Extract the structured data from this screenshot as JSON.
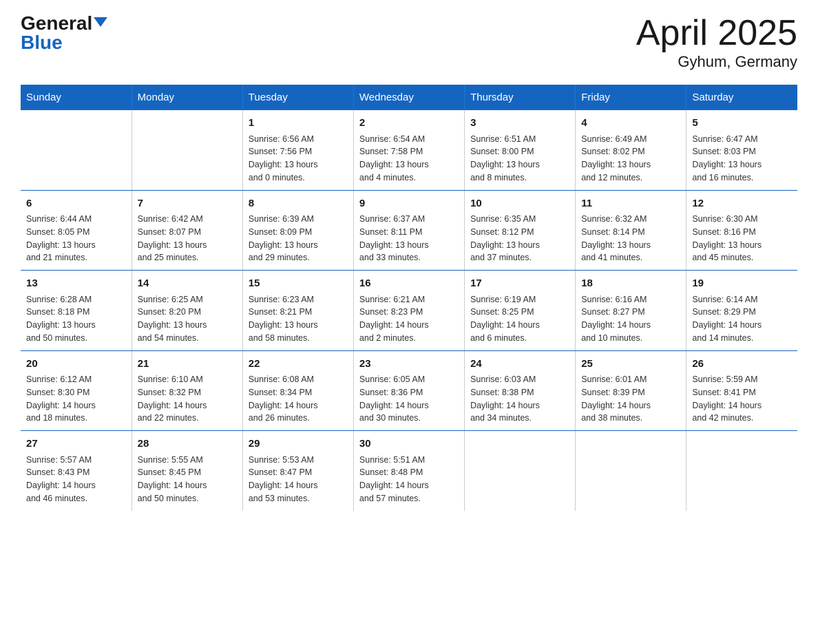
{
  "header": {
    "logo_general": "General",
    "logo_blue": "Blue",
    "month_title": "April 2025",
    "location": "Gyhum, Germany"
  },
  "days_of_week": [
    "Sunday",
    "Monday",
    "Tuesday",
    "Wednesday",
    "Thursday",
    "Friday",
    "Saturday"
  ],
  "weeks": [
    {
      "days": [
        {
          "number": "",
          "info": ""
        },
        {
          "number": "",
          "info": ""
        },
        {
          "number": "1",
          "info": "Sunrise: 6:56 AM\nSunset: 7:56 PM\nDaylight: 13 hours\nand 0 minutes."
        },
        {
          "number": "2",
          "info": "Sunrise: 6:54 AM\nSunset: 7:58 PM\nDaylight: 13 hours\nand 4 minutes."
        },
        {
          "number": "3",
          "info": "Sunrise: 6:51 AM\nSunset: 8:00 PM\nDaylight: 13 hours\nand 8 minutes."
        },
        {
          "number": "4",
          "info": "Sunrise: 6:49 AM\nSunset: 8:02 PM\nDaylight: 13 hours\nand 12 minutes."
        },
        {
          "number": "5",
          "info": "Sunrise: 6:47 AM\nSunset: 8:03 PM\nDaylight: 13 hours\nand 16 minutes."
        }
      ]
    },
    {
      "days": [
        {
          "number": "6",
          "info": "Sunrise: 6:44 AM\nSunset: 8:05 PM\nDaylight: 13 hours\nand 21 minutes."
        },
        {
          "number": "7",
          "info": "Sunrise: 6:42 AM\nSunset: 8:07 PM\nDaylight: 13 hours\nand 25 minutes."
        },
        {
          "number": "8",
          "info": "Sunrise: 6:39 AM\nSunset: 8:09 PM\nDaylight: 13 hours\nand 29 minutes."
        },
        {
          "number": "9",
          "info": "Sunrise: 6:37 AM\nSunset: 8:11 PM\nDaylight: 13 hours\nand 33 minutes."
        },
        {
          "number": "10",
          "info": "Sunrise: 6:35 AM\nSunset: 8:12 PM\nDaylight: 13 hours\nand 37 minutes."
        },
        {
          "number": "11",
          "info": "Sunrise: 6:32 AM\nSunset: 8:14 PM\nDaylight: 13 hours\nand 41 minutes."
        },
        {
          "number": "12",
          "info": "Sunrise: 6:30 AM\nSunset: 8:16 PM\nDaylight: 13 hours\nand 45 minutes."
        }
      ]
    },
    {
      "days": [
        {
          "number": "13",
          "info": "Sunrise: 6:28 AM\nSunset: 8:18 PM\nDaylight: 13 hours\nand 50 minutes."
        },
        {
          "number": "14",
          "info": "Sunrise: 6:25 AM\nSunset: 8:20 PM\nDaylight: 13 hours\nand 54 minutes."
        },
        {
          "number": "15",
          "info": "Sunrise: 6:23 AM\nSunset: 8:21 PM\nDaylight: 13 hours\nand 58 minutes."
        },
        {
          "number": "16",
          "info": "Sunrise: 6:21 AM\nSunset: 8:23 PM\nDaylight: 14 hours\nand 2 minutes."
        },
        {
          "number": "17",
          "info": "Sunrise: 6:19 AM\nSunset: 8:25 PM\nDaylight: 14 hours\nand 6 minutes."
        },
        {
          "number": "18",
          "info": "Sunrise: 6:16 AM\nSunset: 8:27 PM\nDaylight: 14 hours\nand 10 minutes."
        },
        {
          "number": "19",
          "info": "Sunrise: 6:14 AM\nSunset: 8:29 PM\nDaylight: 14 hours\nand 14 minutes."
        }
      ]
    },
    {
      "days": [
        {
          "number": "20",
          "info": "Sunrise: 6:12 AM\nSunset: 8:30 PM\nDaylight: 14 hours\nand 18 minutes."
        },
        {
          "number": "21",
          "info": "Sunrise: 6:10 AM\nSunset: 8:32 PM\nDaylight: 14 hours\nand 22 minutes."
        },
        {
          "number": "22",
          "info": "Sunrise: 6:08 AM\nSunset: 8:34 PM\nDaylight: 14 hours\nand 26 minutes."
        },
        {
          "number": "23",
          "info": "Sunrise: 6:05 AM\nSunset: 8:36 PM\nDaylight: 14 hours\nand 30 minutes."
        },
        {
          "number": "24",
          "info": "Sunrise: 6:03 AM\nSunset: 8:38 PM\nDaylight: 14 hours\nand 34 minutes."
        },
        {
          "number": "25",
          "info": "Sunrise: 6:01 AM\nSunset: 8:39 PM\nDaylight: 14 hours\nand 38 minutes."
        },
        {
          "number": "26",
          "info": "Sunrise: 5:59 AM\nSunset: 8:41 PM\nDaylight: 14 hours\nand 42 minutes."
        }
      ]
    },
    {
      "days": [
        {
          "number": "27",
          "info": "Sunrise: 5:57 AM\nSunset: 8:43 PM\nDaylight: 14 hours\nand 46 minutes."
        },
        {
          "number": "28",
          "info": "Sunrise: 5:55 AM\nSunset: 8:45 PM\nDaylight: 14 hours\nand 50 minutes."
        },
        {
          "number": "29",
          "info": "Sunrise: 5:53 AM\nSunset: 8:47 PM\nDaylight: 14 hours\nand 53 minutes."
        },
        {
          "number": "30",
          "info": "Sunrise: 5:51 AM\nSunset: 8:48 PM\nDaylight: 14 hours\nand 57 minutes."
        },
        {
          "number": "",
          "info": ""
        },
        {
          "number": "",
          "info": ""
        },
        {
          "number": "",
          "info": ""
        }
      ]
    }
  ]
}
